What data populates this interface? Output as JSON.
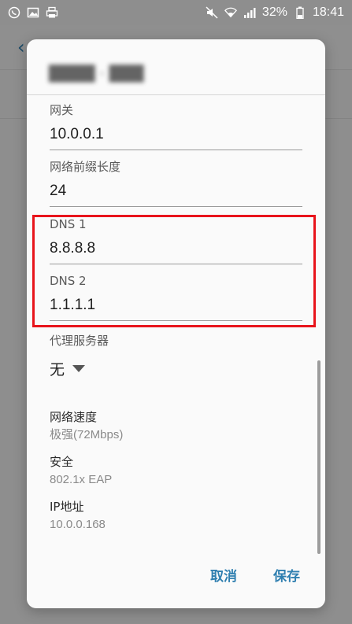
{
  "status_bar": {
    "left_icons": [
      "whatsapp-icon",
      "gallery-icon",
      "printer-icon"
    ],
    "right_icons": [
      "mute-icon",
      "wifi-icon",
      "signal-icon"
    ],
    "battery": "32%",
    "time": "18:41"
  },
  "dialog": {
    "gateway": {
      "label": "网关",
      "value": "10.0.0.1"
    },
    "prefix_length": {
      "label": "网络前缀长度",
      "value": "24"
    },
    "dns1": {
      "label": "DNS 1",
      "value": "8.8.8.8"
    },
    "dns2": {
      "label": "DNS 2",
      "value": "1.1.1.1"
    },
    "proxy": {
      "label": "代理服务器",
      "value": "无"
    },
    "network_speed": {
      "label": "网络速度",
      "value": "极强(72Mbps)"
    },
    "security": {
      "label": "安全",
      "value": "802.1x EAP"
    },
    "ip_address": {
      "label": "IP地址",
      "value": "10.0.0.168"
    },
    "actions": {
      "cancel": "取消",
      "save": "保存"
    }
  },
  "colors": {
    "accent": "#2f7fb0",
    "highlight": "#e8141b"
  }
}
